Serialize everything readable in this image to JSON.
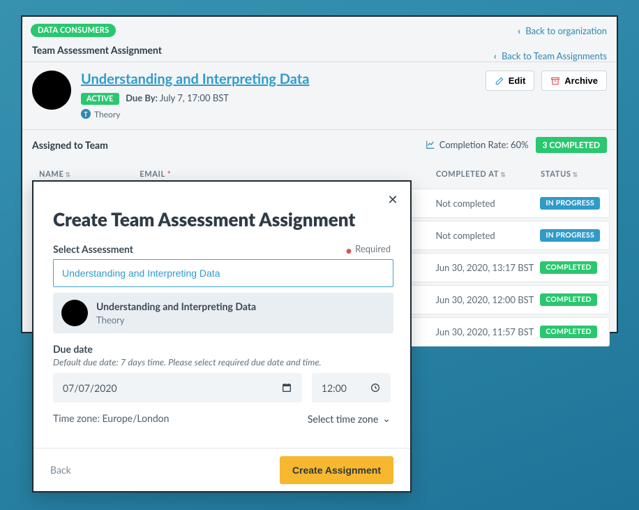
{
  "header": {
    "consumers_badge": "DATA CONSUMERS",
    "back_org": "Back to organization",
    "back_team": "Back to Team Assignments",
    "section_title": "Team Assessment Assignment"
  },
  "assessment": {
    "title": "Understanding and Interpreting Data",
    "status_pill": "ACTIVE",
    "due_label": "Due By:",
    "due_value": "July 7, 17:00 BST",
    "category_icon_letter": "T",
    "category": "Theory",
    "edit_label": "Edit",
    "archive_label": "Archive"
  },
  "assigned": {
    "title": "Assigned to Team",
    "completion_label": "Completion Rate: 60%",
    "completed_pill": "3 COMPLETED",
    "columns": {
      "name": "NAME",
      "email": "EMAIL",
      "completed_at": "COMPLETED AT",
      "status": "STATUS"
    },
    "rows": [
      {
        "completed_at": "Not completed",
        "status_label": "IN PROGRESS",
        "status_kind": "progress"
      },
      {
        "completed_at": "Not completed",
        "status_label": "IN PROGRESS",
        "status_kind": "progress"
      },
      {
        "completed_at": "Jun 30, 2020, 13:17 BST",
        "status_label": "COMPLETED",
        "status_kind": "complete"
      },
      {
        "completed_at": "Jun 30, 2020, 12:00 BST",
        "status_label": "COMPLETED",
        "status_kind": "complete"
      },
      {
        "completed_at": "Jun 30, 2020, 11:57 BST",
        "status_label": "COMPLETED",
        "status_kind": "complete"
      }
    ]
  },
  "modal": {
    "title": "Create Team Assessment Assignment",
    "select_label": "Select Assessment",
    "required_label": "Required",
    "search_value": "Understanding and Interpreting Data",
    "option": {
      "title": "Understanding and Interpreting Data",
      "subtitle": "Theory"
    },
    "due_label": "Due date",
    "due_help": "Default due date: 7 days time. Please select required due date and time.",
    "date_value": "07/07/2020",
    "time_value": "12:00",
    "timezone_label": "Time zone: Europe/London",
    "timezone_select": "Select time zone",
    "back_label": "Back",
    "create_label": "Create Assignment"
  }
}
